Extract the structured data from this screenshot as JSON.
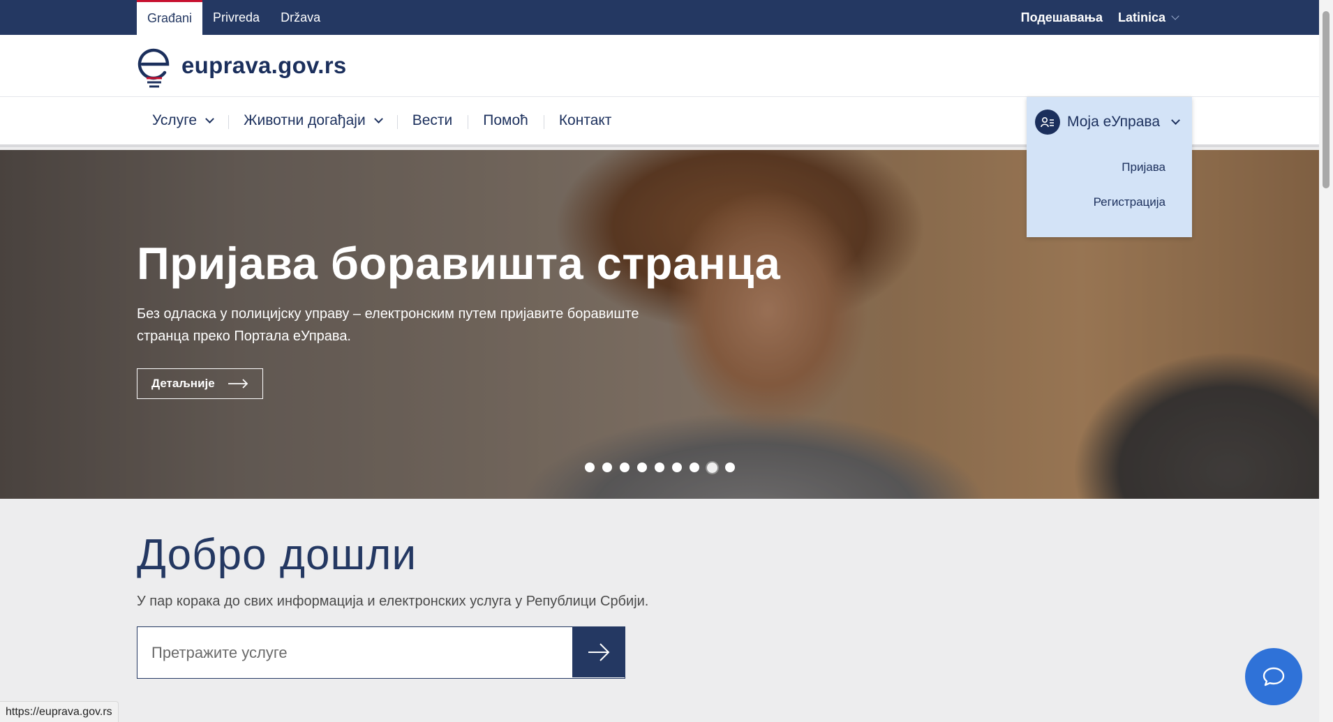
{
  "topbar": {
    "tabs": [
      {
        "label": "Građani",
        "active": true
      },
      {
        "label": "Privreda",
        "active": false
      },
      {
        "label": "Država",
        "active": false
      }
    ],
    "settings_label": "Подешавања",
    "language_label": "Latinica"
  },
  "logo": {
    "text": "euprava.gov.rs"
  },
  "nav": {
    "items": [
      {
        "label": "Услуге",
        "has_dropdown": true
      },
      {
        "label": "Животни догађаји",
        "has_dropdown": true
      },
      {
        "label": "Вести",
        "has_dropdown": false
      },
      {
        "label": "Помоћ",
        "has_dropdown": false
      },
      {
        "label": "Контакт",
        "has_dropdown": false
      }
    ]
  },
  "account_menu": {
    "label": "Моја еУправа",
    "items": [
      "Пријава",
      "Регистрација"
    ]
  },
  "hero": {
    "title": "Пријава боравишта странца",
    "subtitle": "Без одласка у полицијску управу – електронским путем пријавите боравиште странца преко Портала еУправа.",
    "button_label": "Детаљније",
    "slide_count": 9,
    "active_slide": 8
  },
  "welcome": {
    "title": "Добро дошли",
    "subtitle": "У пар корака до свих информација и електронских услуга у Републици Србији.",
    "search_placeholder": "Претражите услуге"
  },
  "status_url": "https://euprava.gov.rs",
  "colors": {
    "brand_navy": "#243862",
    "text_navy": "#1b2f5c",
    "accent_red": "#c8102e",
    "dropdown_bg": "#d3e3f7",
    "chat_blue": "#2f72d8",
    "page_bg": "#ededee"
  }
}
